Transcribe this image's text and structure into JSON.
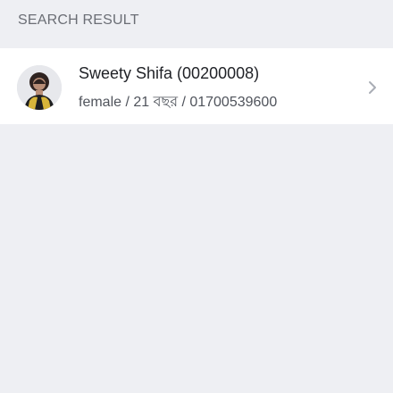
{
  "header": {
    "title": "SEARCH RESULT"
  },
  "results": [
    {
      "name": "Sweety Shifa (00200008)",
      "details": "female / 21 বছর / 01700539600",
      "avatar_icon": "person-photo",
      "action_icon": "chevron-right-icon"
    }
  ],
  "colors": {
    "background": "#eeeff3",
    "card": "#ffffff",
    "header_text": "#6b6e75",
    "name_text": "#1f2126",
    "detail_text": "#50545c",
    "chevron": "#a9adb5"
  }
}
